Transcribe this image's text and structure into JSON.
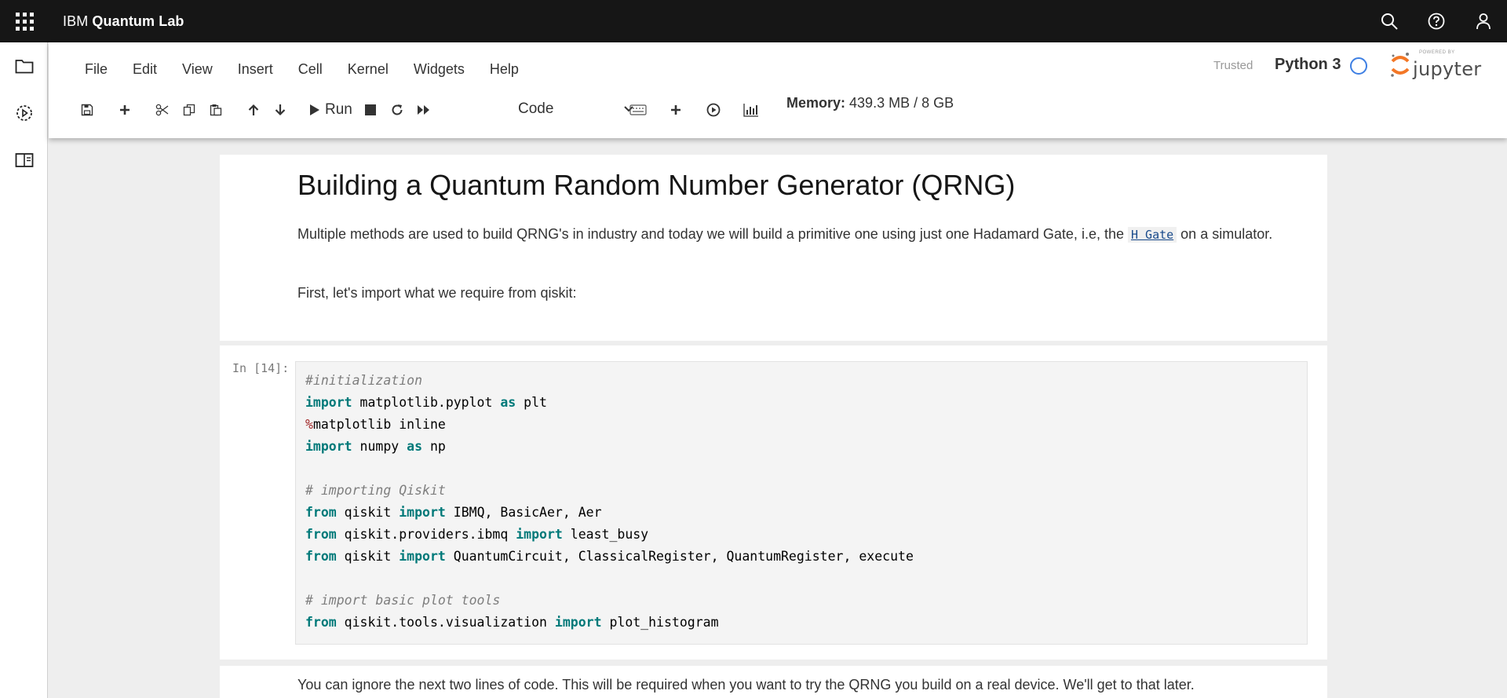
{
  "topbar": {
    "brand_prefix": "IBM",
    "brand_name": "Quantum Lab",
    "icons": [
      "app-switcher-icon",
      "search-icon",
      "help-icon",
      "user-icon"
    ]
  },
  "siderail": {
    "icons": [
      "folder-icon",
      "recent-jobs-icon",
      "documentation-icon"
    ]
  },
  "menubar": {
    "items": [
      "File",
      "Edit",
      "View",
      "Insert",
      "Cell",
      "Kernel",
      "Widgets",
      "Help"
    ]
  },
  "header": {
    "trusted": "Trusted",
    "kernel": "Python 3",
    "logo_text": "jupyter",
    "logo_small": "POWERED BY"
  },
  "toolbar": {
    "run_label": "Run",
    "cell_type": "Code",
    "memory_label": "Memory:",
    "memory_value": "439.3 MB / 8 GB",
    "icons": [
      "save-icon",
      "insert-cell-icon",
      "cut-icon",
      "copy-icon",
      "paste-icon",
      "move-up-icon",
      "move-down-icon",
      "run-icon",
      "stop-icon",
      "restart-icon",
      "fast-forward-icon",
      "keyboard-icon",
      "plus-icon",
      "play-circle-icon",
      "bar-chart-icon"
    ]
  },
  "notebook": {
    "md1": {
      "title": "Building a Quantum Random Number Generator (QRNG)",
      "p1_before": "Multiple methods are used to build QRNG's in industry and today we will build a primitive one using just one Hadamard Gate, i.e, the ",
      "p1_code": "H Gate",
      "p1_after": " on a simulator.",
      "p2": "First, let's import what we require from qiskit:"
    },
    "code1": {
      "prompt": "In [14]:",
      "lines": [
        [
          {
            "t": "#initialization",
            "c": "cm"
          }
        ],
        [
          {
            "t": "import",
            "c": "kw"
          },
          {
            "t": " matplotlib.pyplot ",
            "c": ""
          },
          {
            "t": "as",
            "c": "kw"
          },
          {
            "t": " plt",
            "c": ""
          }
        ],
        [
          {
            "t": "%",
            "c": "mg"
          },
          {
            "t": "matplotlib inline",
            "c": ""
          }
        ],
        [
          {
            "t": "import",
            "c": "kw"
          },
          {
            "t": " numpy ",
            "c": ""
          },
          {
            "t": "as",
            "c": "kw"
          },
          {
            "t": " np",
            "c": ""
          }
        ],
        [
          {
            "t": "",
            "c": ""
          }
        ],
        [
          {
            "t": "# importing Qiskit",
            "c": "cm"
          }
        ],
        [
          {
            "t": "from",
            "c": "kw"
          },
          {
            "t": " qiskit ",
            "c": ""
          },
          {
            "t": "import",
            "c": "kw"
          },
          {
            "t": " IBMQ, BasicAer, Aer",
            "c": ""
          }
        ],
        [
          {
            "t": "from",
            "c": "kw"
          },
          {
            "t": " qiskit.providers.ibmq ",
            "c": ""
          },
          {
            "t": "import",
            "c": "kw"
          },
          {
            "t": " least_busy",
            "c": ""
          }
        ],
        [
          {
            "t": "from",
            "c": "kw"
          },
          {
            "t": " qiskit ",
            "c": ""
          },
          {
            "t": "import",
            "c": "kw"
          },
          {
            "t": " QuantumCircuit, ClassicalRegister, QuantumRegister, execute",
            "c": ""
          }
        ],
        [
          {
            "t": "",
            "c": ""
          }
        ],
        [
          {
            "t": "# import basic plot tools",
            "c": "cm"
          }
        ],
        [
          {
            "t": "from",
            "c": "kw"
          },
          {
            "t": " qiskit.tools.visualization ",
            "c": ""
          },
          {
            "t": "import",
            "c": "kw"
          },
          {
            "t": " plot_histogram",
            "c": ""
          }
        ]
      ]
    },
    "md2": {
      "text": "You can ignore the next two lines of code. This will be required when you want to try the QRNG you build on a real device. We'll get to that later."
    }
  },
  "colors": {
    "topbar_bg": "#161616",
    "keyword": "#007979",
    "comment": "#7e7e7e",
    "magic": "#a22b2b",
    "kernel_indicator": "#3d7fe3",
    "jupyter_orange": "#f37726"
  }
}
